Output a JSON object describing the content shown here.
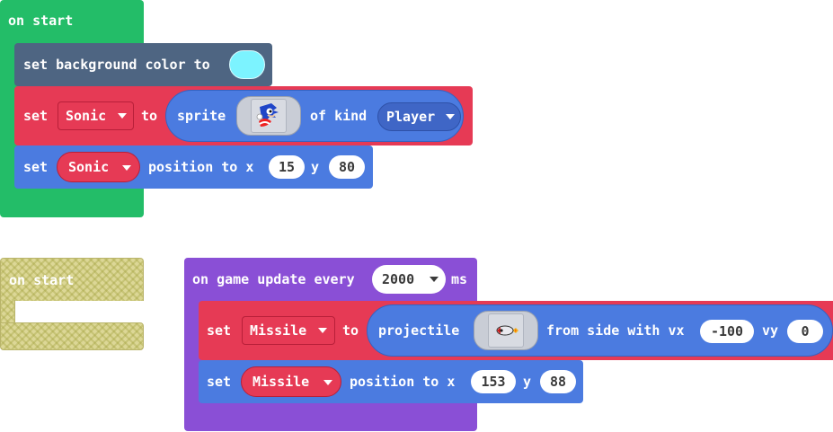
{
  "block_group_1": {
    "hat_label": "on start",
    "bg_block": {
      "label": "set background color to",
      "swatch_color": "#7cf3ff"
    },
    "sprite_block": {
      "set_label": "set",
      "var_name": "Sonic",
      "to_label": "to",
      "sprite_label": "sprite",
      "image_icon": "sonic-sprite-icon",
      "kind_label": "of kind",
      "kind_value": "Player"
    },
    "pos_block": {
      "set_label": "set",
      "var_name": "Sonic",
      "position_label": "position to x",
      "x_value": "15",
      "y_label": "y",
      "y_value": "80"
    }
  },
  "block_group_disabled": {
    "hat_label": "on start"
  },
  "block_group_2": {
    "hat_label_a": "on game update every",
    "interval_value": "2000",
    "hat_label_b": "ms",
    "proj_block": {
      "set_label": "set",
      "var_name": "Missile",
      "to_label": "to",
      "projectile_label": "projectile",
      "image_icon": "missile-sprite-icon",
      "side_label": "from side with vx",
      "vx_value": "-100",
      "vy_label": "vy",
      "vy_value": "0"
    },
    "pos_block": {
      "set_label": "set",
      "var_name": "Missile",
      "position_label": "position to x",
      "x_value": "153",
      "y_label": "y",
      "y_value": "88"
    }
  },
  "colors": {
    "event_green": "#23bd68",
    "scene_dark": "#4e6582",
    "sprite_red": "#e63a55",
    "sprite_blue": "#4b7be0",
    "game_purple": "#8a4fd6"
  }
}
